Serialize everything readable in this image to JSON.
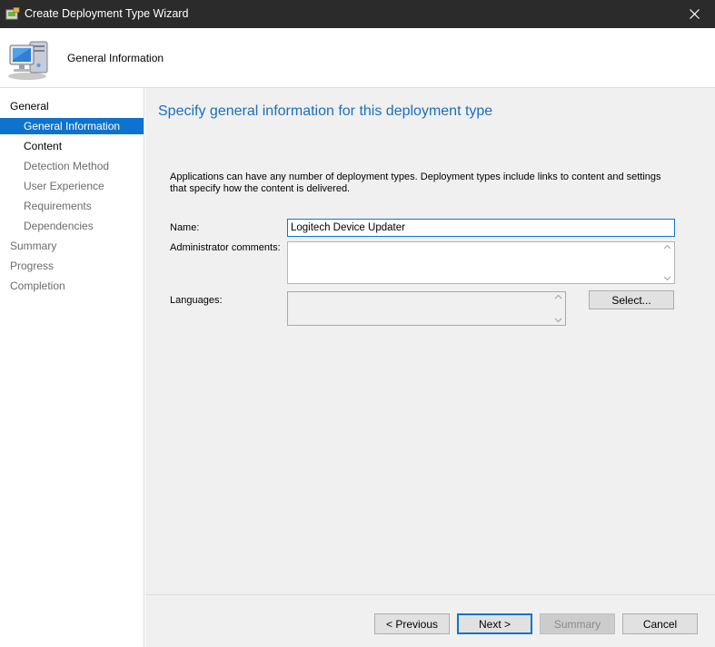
{
  "window": {
    "title": "Create Deployment Type Wizard"
  },
  "header": {
    "title": "General Information"
  },
  "nav": {
    "items": [
      {
        "label": "General",
        "level": 0,
        "state": "normal"
      },
      {
        "label": "General Information",
        "level": 1,
        "state": "active"
      },
      {
        "label": "Content",
        "level": 1,
        "state": "normal"
      },
      {
        "label": "Detection Method",
        "level": 1,
        "state": "dim"
      },
      {
        "label": "User Experience",
        "level": 1,
        "state": "dim"
      },
      {
        "label": "Requirements",
        "level": 1,
        "state": "dim"
      },
      {
        "label": "Dependencies",
        "level": 1,
        "state": "dim"
      },
      {
        "label": "Summary",
        "level": 0,
        "state": "dim"
      },
      {
        "label": "Progress",
        "level": 0,
        "state": "dim"
      },
      {
        "label": "Completion",
        "level": 0,
        "state": "dim"
      }
    ]
  },
  "main": {
    "heading": "Specify general information for this deployment type",
    "description": "Applications can have any number of deployment types. Deployment types include links to content and settings that specify how the content is delivered.",
    "name_label": "Name:",
    "name_value": "Logitech Device Updater",
    "admin_comments_label": "Administrator comments:",
    "admin_comments_value": "",
    "languages_label": "Languages:",
    "select_button": "Select..."
  },
  "footer": {
    "previous": "< Previous",
    "next": "Next >",
    "summary": "Summary",
    "cancel": "Cancel"
  },
  "colors": {
    "accent": "#0e73cf",
    "heading": "#1a6fbf",
    "titlebar": "#2b2b2b"
  },
  "icons": {
    "app": "wizard-app-icon",
    "header": "computer-icon",
    "close": "close-icon"
  }
}
